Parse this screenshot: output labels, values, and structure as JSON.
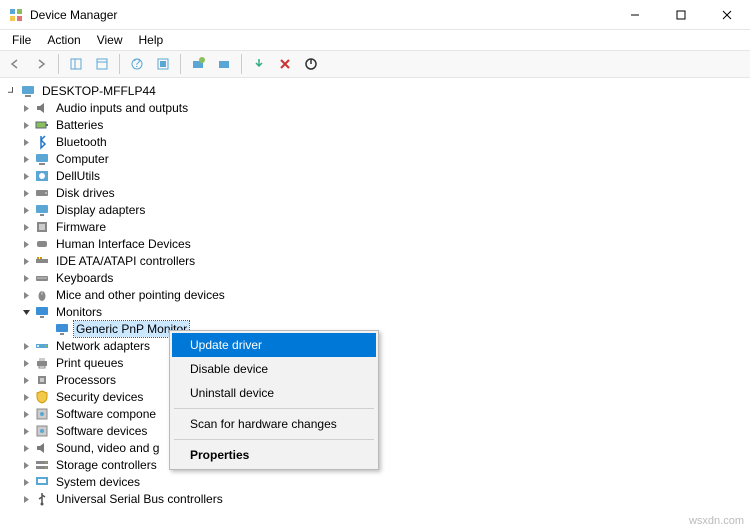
{
  "window": {
    "title": "Device Manager"
  },
  "menu": {
    "file": "File",
    "action": "Action",
    "view": "View",
    "help": "Help"
  },
  "tree": {
    "root": "DESKTOP-MFFLP44",
    "items": [
      {
        "label": "Audio inputs and outputs",
        "icon": "speaker"
      },
      {
        "label": "Batteries",
        "icon": "battery"
      },
      {
        "label": "Bluetooth",
        "icon": "bluetooth"
      },
      {
        "label": "Computer",
        "icon": "computer"
      },
      {
        "label": "DellUtils",
        "icon": "dell"
      },
      {
        "label": "Disk drives",
        "icon": "disk"
      },
      {
        "label": "Display adapters",
        "icon": "display"
      },
      {
        "label": "Firmware",
        "icon": "firmware"
      },
      {
        "label": "Human Interface Devices",
        "icon": "hid"
      },
      {
        "label": "IDE ATA/ATAPI controllers",
        "icon": "ide"
      },
      {
        "label": "Keyboards",
        "icon": "keyboard"
      },
      {
        "label": "Mice and other pointing devices",
        "icon": "mouse"
      },
      {
        "label": "Monitors",
        "icon": "monitor",
        "expanded": true,
        "children": [
          {
            "label": "Generic PnP Monitor",
            "icon": "monitor",
            "selected": true
          }
        ]
      },
      {
        "label": "Network adapters",
        "icon": "network"
      },
      {
        "label": "Print queues",
        "icon": "printer"
      },
      {
        "label": "Processors",
        "icon": "cpu"
      },
      {
        "label": "Security devices",
        "icon": "security"
      },
      {
        "label": "Software components",
        "icon": "software",
        "truncated": "Software compone"
      },
      {
        "label": "Software devices",
        "icon": "software"
      },
      {
        "label": "Sound, video and game controllers",
        "icon": "speaker",
        "truncated": "Sound, video and g"
      },
      {
        "label": "Storage controllers",
        "icon": "storage"
      },
      {
        "label": "System devices",
        "icon": "system"
      },
      {
        "label": "Universal Serial Bus controllers",
        "icon": "usb"
      }
    ]
  },
  "context": {
    "update": "Update driver",
    "disable": "Disable device",
    "uninstall": "Uninstall device",
    "scan": "Scan for hardware changes",
    "properties": "Properties"
  },
  "watermark": "wsxdn.com"
}
